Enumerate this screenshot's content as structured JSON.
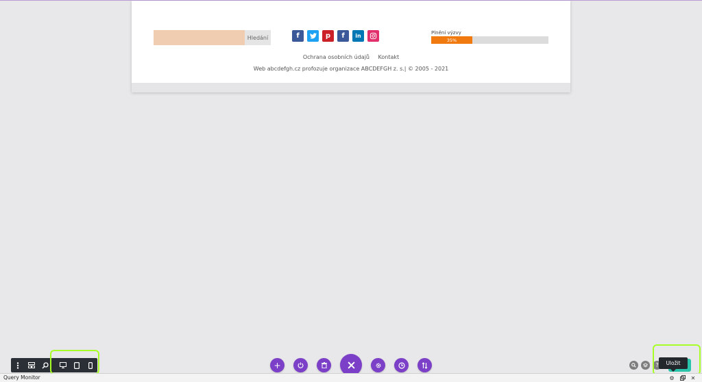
{
  "page": {
    "search": {
      "button_label": "Hledání",
      "placeholder": ""
    },
    "social": [
      {
        "name": "facebook",
        "glyph": "f",
        "color": "#3b5998"
      },
      {
        "name": "twitter",
        "glyph": "t",
        "color": "#1da1f2"
      },
      {
        "name": "pinterest",
        "glyph": "p",
        "color": "#cb2027"
      },
      {
        "name": "facebook",
        "glyph": "f",
        "color": "#3b5998"
      },
      {
        "name": "linkedin",
        "glyph": "in",
        "color": "#0077b5"
      },
      {
        "name": "instagram",
        "glyph": "◎",
        "color": "#e1306c"
      }
    ],
    "challenge": {
      "label": "Plnění výzvy",
      "percent": 35,
      "percent_text": "35%",
      "color": "#f07a10"
    },
    "footer": {
      "privacy_link": "Ochrana osobních údajů",
      "contact_link": "Kontakt",
      "copyright": "Web abcdefgh.cz profozuje organizace ABCDEFGH z. s.| © 2005 - 2021"
    }
  },
  "builder": {
    "left_toolbar": [
      "menu-icon",
      "wireframe-icon",
      "zoom-icon",
      "desktop-icon",
      "tablet-icon",
      "phone-icon"
    ],
    "center_actions": [
      "add-icon",
      "power-icon",
      "trash-icon",
      "close-icon",
      "settings-icon",
      "history-icon",
      "sort-icon"
    ],
    "right_controls": [
      "search-icon",
      "layers-icon",
      "help-icon"
    ],
    "save_tooltip": "Uložit",
    "accent_purple": "#7c3fc7",
    "save_color": "#29c4a9",
    "highlight_color": "#a8ff26"
  },
  "admin_bar": {
    "query_monitor": "Query Monitor",
    "icons": [
      "gear-icon",
      "window-icon",
      "close-icon"
    ]
  }
}
